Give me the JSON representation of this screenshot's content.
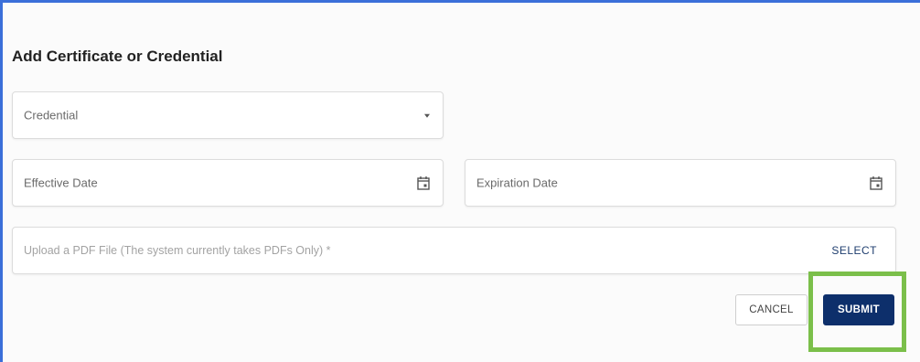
{
  "dialog": {
    "title": "Add Certificate or Credential"
  },
  "fields": {
    "credential": {
      "placeholder": "Credential",
      "icon": "chevron-down-icon"
    },
    "effective_date": {
      "placeholder": "Effective Date",
      "icon": "calendar-icon"
    },
    "expiration_date": {
      "placeholder": "Expiration Date",
      "icon": "calendar-icon"
    },
    "upload": {
      "placeholder": "Upload a PDF File (The system currently takes PDFs Only) *",
      "action_label": "SELECT"
    }
  },
  "actions": {
    "cancel_label": "CANCEL",
    "submit_label": "SUBMIT"
  },
  "colors": {
    "frame_border": "#3b6fd9",
    "submit_bg": "#0d2f6b",
    "highlight": "#7bbf4a"
  }
}
